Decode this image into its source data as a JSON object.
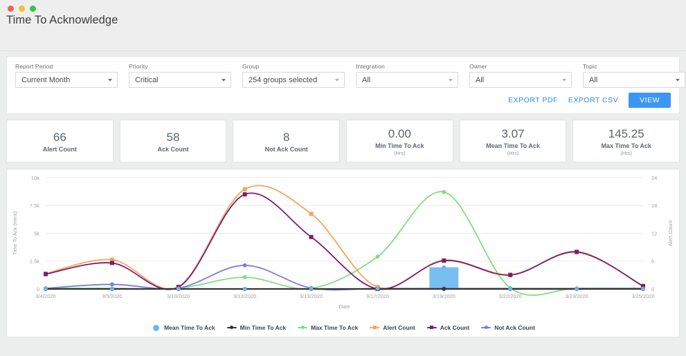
{
  "window": {
    "title": "Time To Acknowledge",
    "buttons": [
      "close",
      "minimize",
      "maximize"
    ]
  },
  "filters": [
    {
      "name": "report-period",
      "label": "Report Period",
      "value": "Current Month",
      "caret": "dark"
    },
    {
      "name": "priority",
      "label": "Priority",
      "value": "Critical",
      "caret": "dark"
    },
    {
      "name": "group",
      "label": "Group",
      "value": "254 groups selected",
      "caret": "light"
    },
    {
      "name": "integration",
      "label": "Integration",
      "value": "All",
      "caret": "light"
    },
    {
      "name": "owner",
      "label": "Owner",
      "value": "All",
      "caret": "light"
    },
    {
      "name": "topic",
      "label": "Topic",
      "value": "All",
      "caret": "dark"
    }
  ],
  "actions": {
    "export_pdf": "EXPORT PDF",
    "export_csv": "EXPORT CSV",
    "view": "VIEW",
    "accent": "#3b97f3",
    "link_color": "#2d8cf0"
  },
  "kpis": [
    {
      "value": "66",
      "label": "Alert Count",
      "unit": ""
    },
    {
      "value": "58",
      "label": "Ack Count",
      "unit": ""
    },
    {
      "value": "8",
      "label": "Not Ack Count",
      "unit": ""
    },
    {
      "value": "0.00",
      "label": "Min Time To Ack",
      "unit": "(Hrs)"
    },
    {
      "value": "3.07",
      "label": "Mean Time To Ack",
      "unit": "(Hrs)"
    },
    {
      "value": "145.25",
      "label": "Max Time To Ack",
      "unit": "(Hrs)"
    }
  ],
  "chart_data": {
    "type": "line",
    "title": "",
    "xlabel": "Date",
    "ylabel": "Time To Ack (mins)",
    "y2label": "Alert Count",
    "grid": true,
    "legend_position": "bottom",
    "categories": [
      "3/4/2020",
      "3/5/2020",
      "3/10/2020",
      "3/12/2020",
      "3/13/2020",
      "3/17/2020",
      "3/19/2020",
      "3/22/2020",
      "3/23/2020",
      "3/25/2020"
    ],
    "ylim": [
      0,
      10000
    ],
    "yticks": [
      "0",
      "2.5k",
      "5k",
      "7.5k",
      "10k"
    ],
    "ytick_values": [
      0,
      2500,
      5000,
      7500,
      10000
    ],
    "y2lim": [
      0,
      24
    ],
    "y2ticks": [
      "0",
      "6",
      "12",
      "18",
      "24"
    ],
    "y2tick_values": [
      0,
      6,
      12,
      18,
      24
    ],
    "series": [
      {
        "name": "Mean Time To Ack",
        "color": "#6ab7f0",
        "axis": "left",
        "render": "bar",
        "marker": "circle",
        "values": [
          30,
          30,
          30,
          30,
          30,
          30,
          1950,
          30,
          30,
          30
        ]
      },
      {
        "name": "Min Time To Ack",
        "color": "#333333",
        "axis": "left",
        "render": "line",
        "marker": "circle",
        "values": [
          0,
          0,
          0,
          0,
          0,
          0,
          0,
          0,
          0,
          0
        ]
      },
      {
        "name": "Max Time To Ack",
        "color": "#7ee07a",
        "axis": "left",
        "render": "line",
        "marker": "circle",
        "values": [
          60,
          60,
          60,
          1050,
          60,
          2900,
          8715,
          90,
          60,
          60
        ]
      },
      {
        "name": "Alert Count",
        "color": "#f6a35c",
        "axis": "right",
        "render": "line",
        "marker": "square",
        "values": [
          3.3,
          6.3,
          0.5,
          21.5,
          16.2,
          0.4,
          6.2,
          3.1,
          7.9,
          0.7
        ]
      },
      {
        "name": "Ack Count",
        "color": "#7b1e6e",
        "axis": "right",
        "render": "line",
        "marker": "square",
        "values": [
          3.2,
          5.6,
          0.4,
          20.4,
          11.2,
          0.0,
          6.1,
          3.0,
          8.0,
          0.6
        ]
      },
      {
        "name": "Not Ack Count",
        "color": "#7b7be0",
        "axis": "right",
        "render": "line",
        "marker": "circle",
        "values": [
          0.15,
          1.0,
          0.2,
          5.1,
          0.2,
          0.1,
          0.1,
          0.1,
          0.1,
          0.1
        ]
      }
    ]
  }
}
